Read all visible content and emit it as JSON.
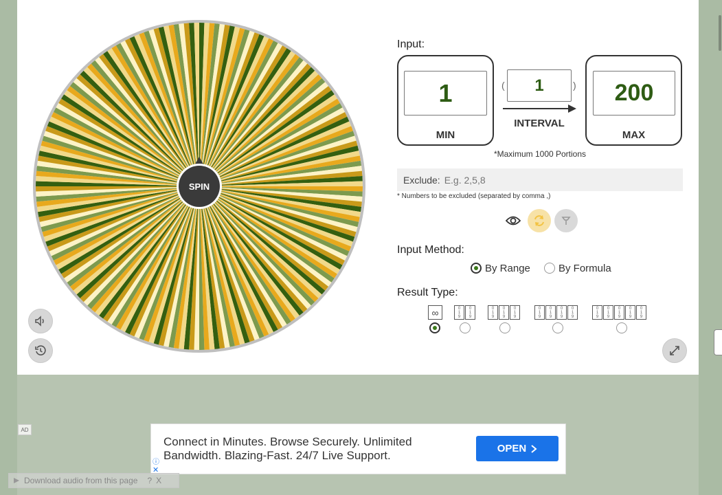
{
  "wheel": {
    "spin_label": "SPIN",
    "slice_colors": [
      "#345f10",
      "#f1d98a",
      "#e8a91d",
      "#7d9a4e",
      "#fdf3c6",
      "#c99a19"
    ],
    "rim_color": "#bfbfbf",
    "hub_color": "#3a3a3a"
  },
  "side_buttons": {
    "sound_icon": "speaker-icon",
    "history_icon": "history-icon",
    "fullscreen_icon": "expand-icon"
  },
  "input": {
    "title": "Input:",
    "min_value": "1",
    "min_label": "MIN",
    "interval_value": "1",
    "interval_label": "INTERVAL",
    "max_value": "200",
    "max_label": "MAX",
    "paren_open": "(",
    "paren_close": ")",
    "max_portions_note": "*Maximum 1000 Portions"
  },
  "exclude": {
    "label": "Exclude:",
    "placeholder": "E.g. 2,5,8",
    "note": "* Numbers to be excluded (separated by comma ,)"
  },
  "actions": {
    "icons": [
      "eye-icon",
      "refresh-icon",
      "clear-icon"
    ],
    "accent": "#f3c343"
  },
  "input_method": {
    "title": "Input Method:",
    "options": [
      {
        "label": "By Range",
        "selected": true
      },
      {
        "label": "By Formula",
        "selected": false
      }
    ]
  },
  "result_type": {
    "title": "Result Type:",
    "infinity_symbol": "∞",
    "digit_options": [
      2,
      3,
      4,
      5
    ],
    "selected_index": 0
  },
  "ad": {
    "tag": "AD",
    "text": "Connect in Minutes. Browse Securely. Unlimited Bandwidth. Blazing-Fast. 24/7 Live Support.",
    "button_label": "OPEN",
    "button_color": "#1a73e8"
  },
  "download_bar": {
    "label": "Download audio from this page",
    "help": "?",
    "close": "X"
  }
}
